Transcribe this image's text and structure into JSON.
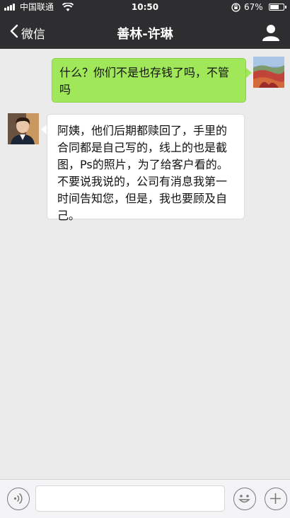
{
  "status_bar": {
    "carrier": "中国联通",
    "time": "10:50",
    "battery": "67%",
    "battery_level": 0.67
  },
  "nav": {
    "back_label": "微信",
    "title": "善林-许琳"
  },
  "messages": [
    {
      "direction": "outgoing",
      "text": "什么？你们不是也存钱了吗，不管吗"
    },
    {
      "direction": "incoming",
      "text": "阿姨，他们后期都赎回了，手里的合同都是自己写的，线上的也是截图，Ps的照片，为了给客户看的。不要说我说的，公司有消息我第一时间告知您，但是，我也要顾及自己。"
    }
  ],
  "input_bar": {
    "voice_icon": "voice-icon",
    "emoji_icon": "emoji-icon",
    "plus_icon": "plus-icon"
  }
}
